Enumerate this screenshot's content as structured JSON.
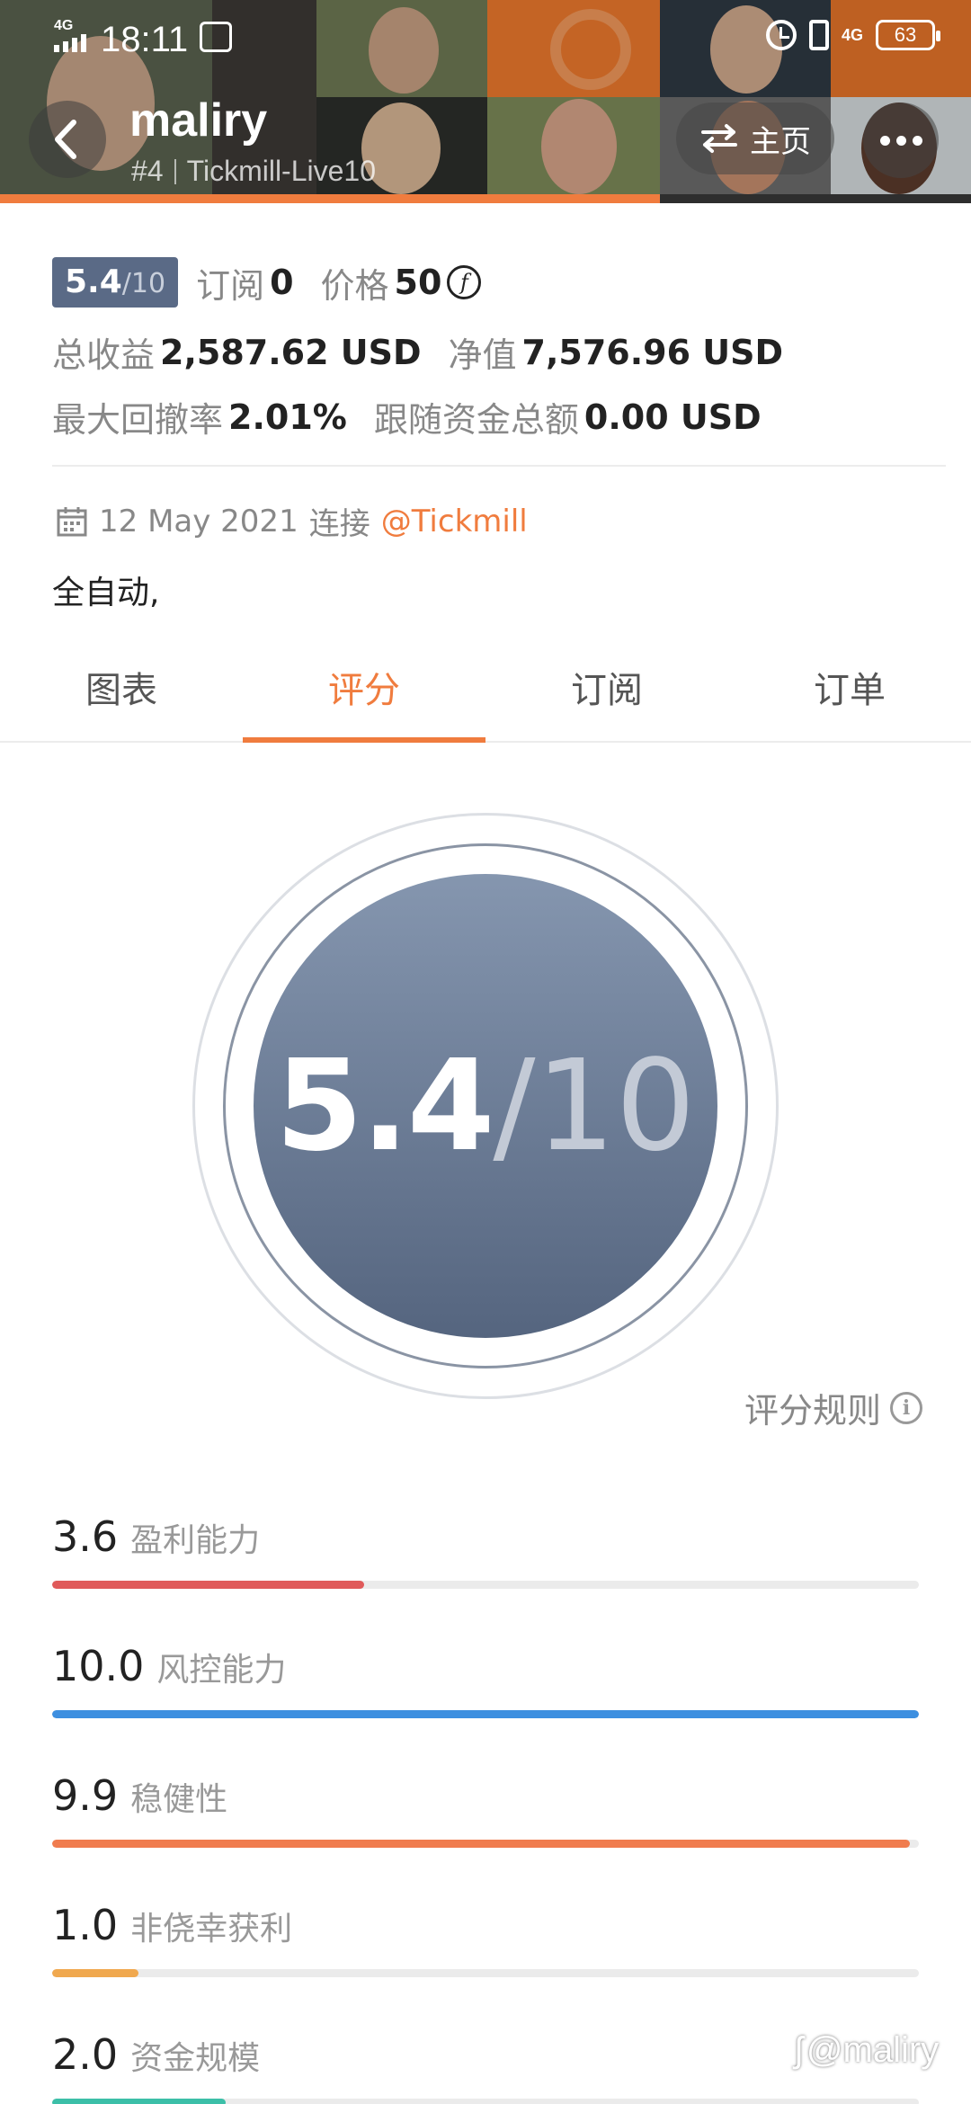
{
  "status_bar": {
    "network": "4G",
    "time": "18:11",
    "network_right": "4G",
    "battery": "63"
  },
  "header": {
    "name": "maliry",
    "rank": "#4",
    "account": "Tickmill-Live10",
    "home_label": "主页"
  },
  "summary": {
    "score": "5.4",
    "score_den": "/10",
    "subscribers_label": "订阅",
    "subscribers": "0",
    "price_label": "价格",
    "price": "50",
    "price_icon": "f",
    "total_profit_label": "总收益",
    "total_profit": "2,587.62 USD",
    "net_value_label": "净值",
    "net_value": "7,576.96 USD",
    "max_drawdown_label": "最大回撤率",
    "max_drawdown": "2.01%",
    "follow_funds_label": "跟随资金总额",
    "follow_funds": "0.00 USD"
  },
  "connection": {
    "date": "12 May 2021",
    "connect_label": "连接",
    "broker": "@Tickmill"
  },
  "description": "全自动,",
  "tabs": [
    {
      "label": "图表"
    },
    {
      "label": "评分"
    },
    {
      "label": "订阅"
    },
    {
      "label": "订单"
    }
  ],
  "active_tab": "评分",
  "rating": {
    "score": "5.4",
    "slash": "/",
    "den": "10",
    "rules_label": "评分规则"
  },
  "metrics": [
    {
      "value": "3.6",
      "label": "盈利能力",
      "fraction": 0.36,
      "color": "#e05a5a"
    },
    {
      "value": "10.0",
      "label": "风控能力",
      "fraction": 1.0,
      "color": "#3d8fe0"
    },
    {
      "value": "9.9",
      "label": "稳健性",
      "fraction": 0.99,
      "color": "#f07c4e"
    },
    {
      "value": "1.0",
      "label": "非侥幸获利",
      "fraction": 0.1,
      "color": "#f0a84e"
    },
    {
      "value": "2.0",
      "label": "资金规模",
      "fraction": 0.2,
      "color": "#3cbfa8"
    }
  ],
  "colors": {
    "accent": "#f07c3e",
    "score_badge": "#5a6a86"
  },
  "watermark": "@maliry"
}
